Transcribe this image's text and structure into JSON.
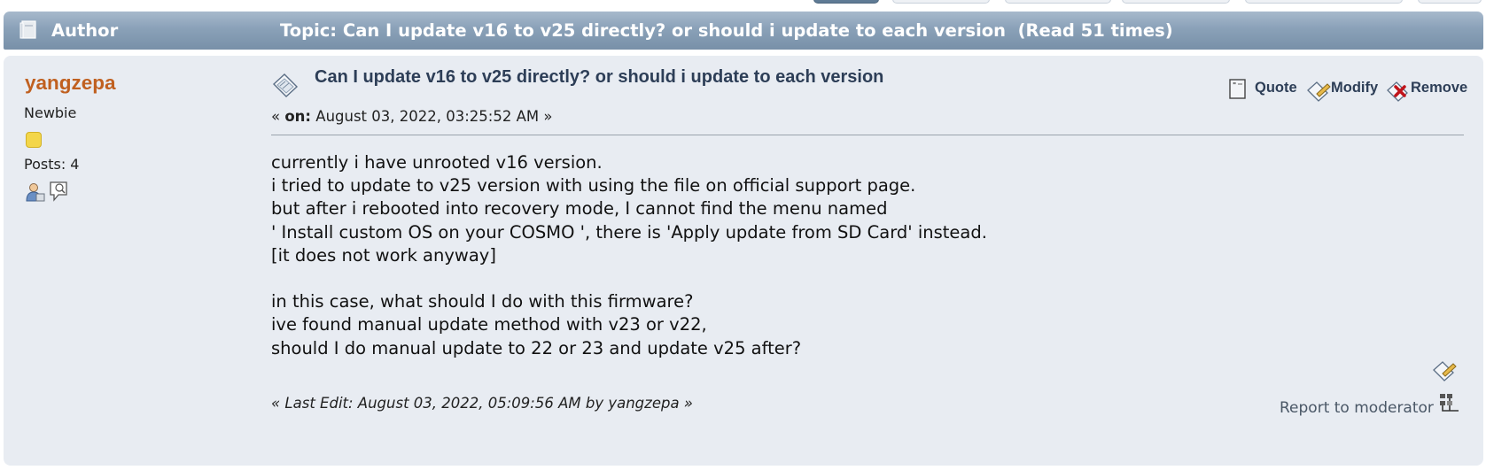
{
  "header": {
    "author_label": "Author",
    "topic_label": "Topic: Can I update v16 to v25 directly? or should i update to each version  (Read 51 times)"
  },
  "post": {
    "poster": {
      "name": "yangzepa",
      "rank": "Newbie",
      "posts": "Posts: 4"
    },
    "subject": "Can I update v16 to v25 directly? or should i update to each version",
    "posted_on": {
      "open": "« ",
      "on_label": "on:",
      "date": " August 03, 2022, 03:25:52 AM »"
    },
    "buttons": {
      "quote": "Quote",
      "modify": "Modify",
      "remove": "Remove"
    },
    "body_lines": [
      "currently i have unrooted v16 version.",
      "i tried to update to v25 version with using the file on official support page.",
      "but after i rebooted into recovery mode, I cannot find the menu named",
      "' Install custom OS on your COSMO ', there is 'Apply update from SD Card' instead.",
      "[it does not work anyway]",
      "",
      "in this case, what should I do with this firmware?",
      "ive found manual update method with v23 or v22,",
      "should I do manual update to 22 or 23 and update v25 after?"
    ],
    "last_edit": "« Last Edit: August 03, 2022, 05:09:56 AM by yangzepa »",
    "report_label": "Report to moderator"
  },
  "colors": {
    "header_bar": "#8aa1b8",
    "post_bg": "#e8ecf2",
    "poster_name": "#c06020",
    "subject": "#2d3e57"
  }
}
